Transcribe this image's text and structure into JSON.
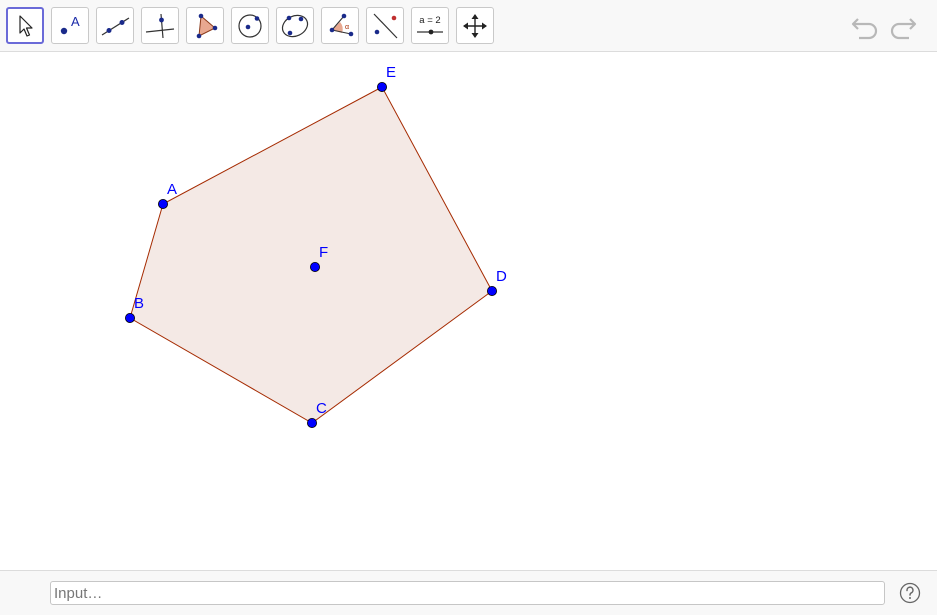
{
  "toolbar": {
    "tools": [
      {
        "name": "move-tool",
        "icon": "pointer-arrow-icon",
        "active": true
      },
      {
        "name": "point-tool",
        "icon": "point-icon",
        "label": "A"
      },
      {
        "name": "line-tool",
        "icon": "line-through-points-icon"
      },
      {
        "name": "perpendicular-line-tool",
        "icon": "perpendicular-line-icon"
      },
      {
        "name": "polygon-tool",
        "icon": "polygon-icon"
      },
      {
        "name": "circle-center-point-tool",
        "icon": "circle-center-icon"
      },
      {
        "name": "conic-five-points-tool",
        "icon": "ellipse-icon"
      },
      {
        "name": "angle-tool",
        "icon": "angle-icon"
      },
      {
        "name": "reflect-about-line-tool",
        "icon": "reflect-line-icon"
      },
      {
        "name": "slider-tool",
        "icon": "slider-icon",
        "label": "a = 2"
      },
      {
        "name": "move-graphics-view-tool",
        "icon": "move-cross-arrows-icon"
      }
    ],
    "undo_icon": "undo-icon",
    "redo_icon": "redo-icon"
  },
  "canvas": {
    "polygon_fill": "#f4e9e5",
    "polygon_stroke": "#a52a00",
    "point_color": "#0000ff",
    "points": [
      {
        "label": "A"
      },
      {
        "label": "B"
      },
      {
        "label": "C"
      },
      {
        "label": "D"
      },
      {
        "label": "E"
      },
      {
        "label": "F"
      }
    ]
  },
  "input_bar": {
    "placeholder": "Input…",
    "help_icon": "help-question-icon"
  }
}
